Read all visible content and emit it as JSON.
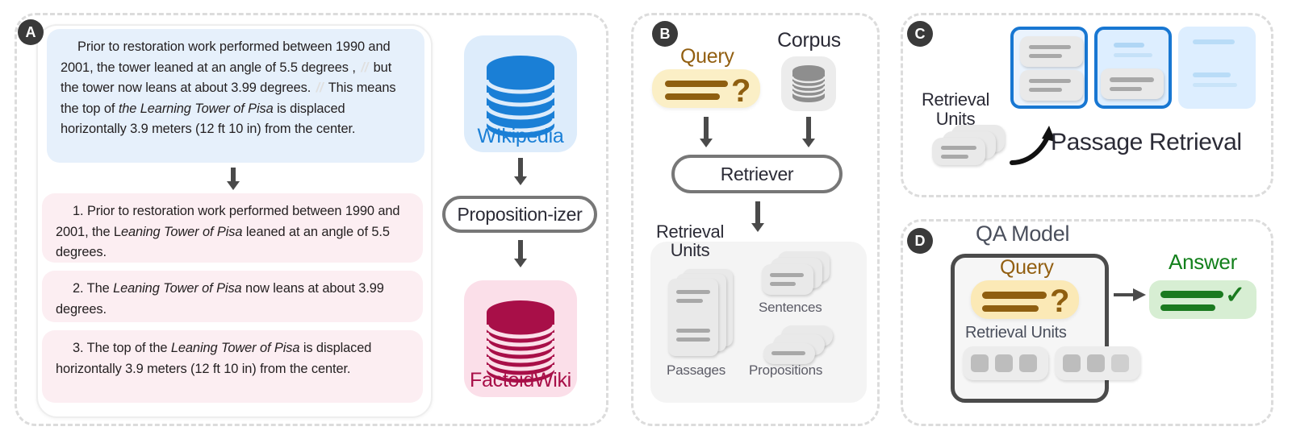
{
  "panels": {
    "a": {
      "badge": "A"
    },
    "b": {
      "badge": "B"
    },
    "c": {
      "badge": "C"
    },
    "d": {
      "badge": "D"
    }
  },
  "panel_a": {
    "source_text": {
      "p1": "Prior to restoration work performed between 1990 and 2001, the tower leaned at an angle of 5.5 degrees ,",
      "sep": "//",
      "p2": "but the tower now leans at about 3.99 degrees.",
      "p3": "This means the top of",
      "p3_italic": "the Learning Tower of Pisa",
      "p4": "is displaced horizontally 3.9 meters (12 ft 10 in) from the center."
    },
    "propositions": [
      {
        "number": "1.",
        "pre": "Prior to restoration work performed between 1990 and 2001, the L",
        "italic": "eaning Tower of Pisa",
        "post": "leaned at an angle of 5.5 degrees."
      },
      {
        "number": "2.",
        "pre": "The",
        "italic": "Leaning Tower of Pisa",
        "post": "now leans at about 3.99 degrees."
      },
      {
        "number": "3.",
        "pre": "The top of the",
        "italic": "Leaning Tower of Pisa",
        "post": "is displaced horizontally 3.9 meters (12 ft 10 in) from the center."
      }
    ],
    "pipeline": {
      "wikipedia_label": "WIkipedia",
      "propositionizer_label": "Proposition-izer",
      "factoidwiki_label": "FactoidWiki",
      "wikipedia_color": "#1a7fd6",
      "wikipedia_tile_color": "#ddecfb",
      "factoidwiki_color": "#a80f48",
      "factoidwiki_tile_color": "#fbdfe9"
    }
  },
  "panel_b": {
    "query_label": "Query",
    "corpus_label": "Corpus",
    "retriever_label": "Retriever",
    "retrieval_units_label": "Retrieval\nUnits",
    "retrieval_units_line1": "Retrieval",
    "retrieval_units_line2": "Units",
    "unit_types": [
      "Passages",
      "Sentences",
      "Propositions"
    ],
    "query_accent": "#8f5f10",
    "query_bg": "#fbefc6"
  },
  "panel_c": {
    "retrieval_units_line1": "Retrieval",
    "retrieval_units_line2": "Units",
    "passage_retrieval_label": "Passage Retrieval",
    "selected_color": "#1877d2",
    "slot_blue": "#ddeeff"
  },
  "panel_d": {
    "qa_model_label": "QA Model",
    "query_label": "Query",
    "retrieval_units_label": "Retrieval Units",
    "answer_label": "Answer",
    "answer_check": "✓",
    "answer_color": "#13801c",
    "answer_bg": "#d7eed3"
  }
}
